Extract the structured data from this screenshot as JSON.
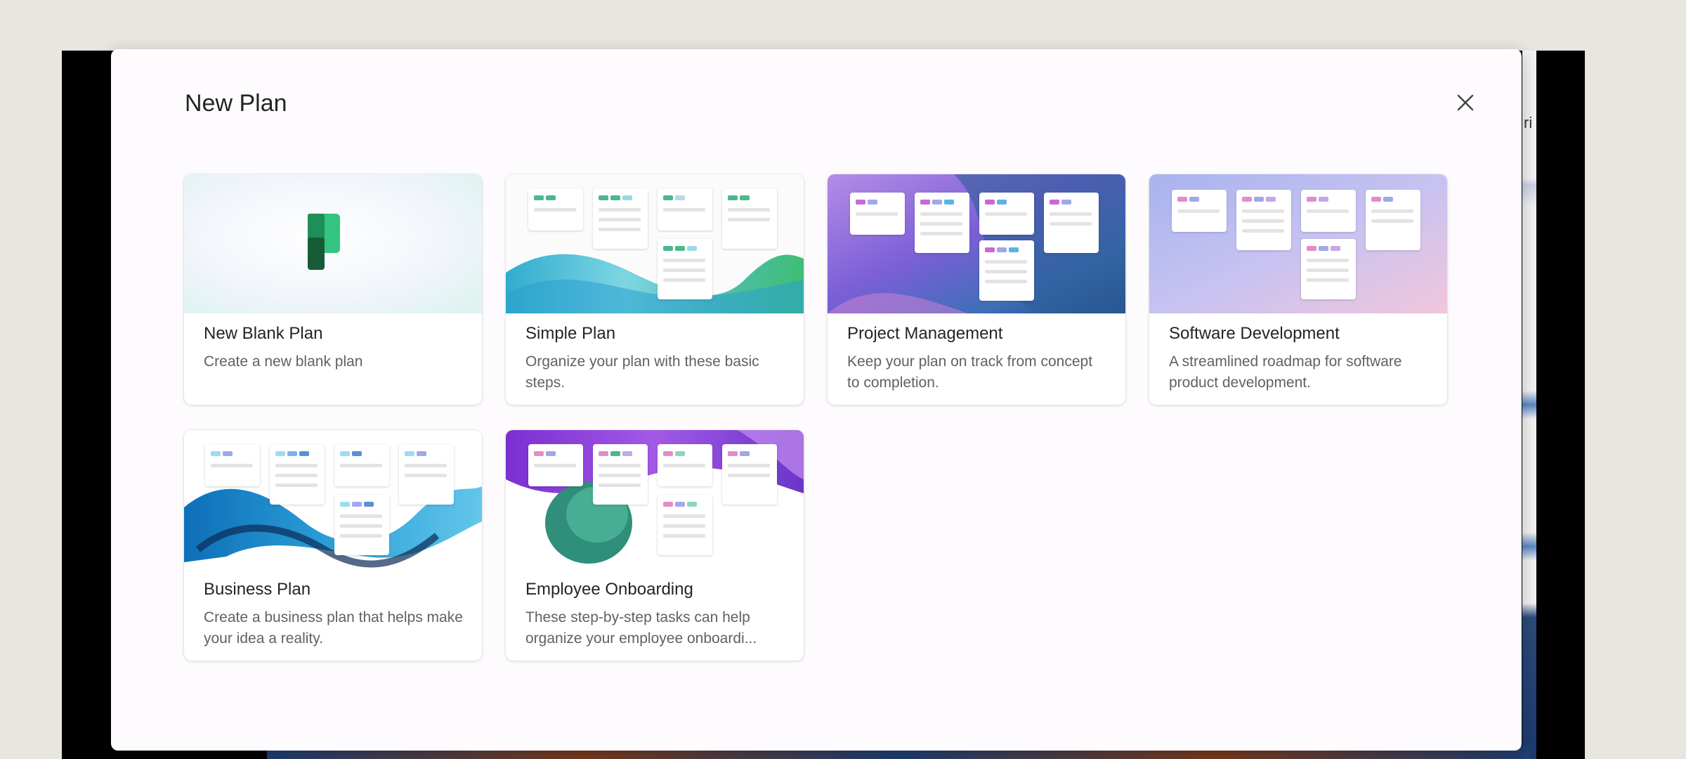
{
  "dialog": {
    "title": "New Plan",
    "close_label": "Close"
  },
  "icons": {
    "close": "close-icon",
    "planner_logo": "planner-logo-icon"
  },
  "templates": [
    {
      "title": "New Blank Plan",
      "description": "Create a new blank plan"
    },
    {
      "title": "Simple Plan",
      "description": "Organize your plan with these basic steps."
    },
    {
      "title": "Project Management",
      "description": "Keep your plan on track from concept to completion."
    },
    {
      "title": "Software Development",
      "description": "A streamlined roadmap for software product development."
    },
    {
      "title": "Business Plan",
      "description": "Create a business plan that helps make your idea a reality."
    },
    {
      "title": "Employee Onboarding",
      "description": "These step-by-step tasks can help organize your employee onboardi..."
    }
  ],
  "colors": {
    "dialog_bg": "#fdfbfd",
    "backdrop": "#e9e6df",
    "planner_green_dark": "#185c37",
    "planner_green": "#21a366",
    "planner_green_light": "#33c481"
  }
}
